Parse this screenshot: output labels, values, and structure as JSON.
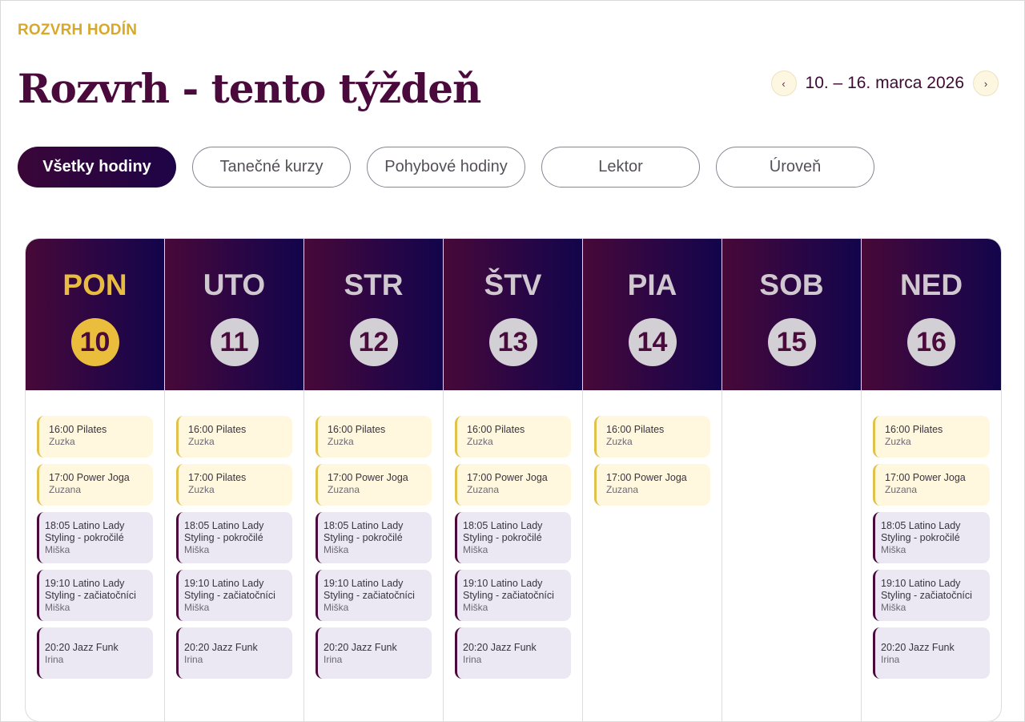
{
  "header": {
    "eyebrow": "ROZVRH HODÍN",
    "title": "Rozvrh - tento týždeň",
    "week_range": "10. – 16. marca 2026",
    "prev_icon": "‹",
    "next_icon": "›"
  },
  "filters": [
    {
      "label": "Všetky hodiny",
      "active": true
    },
    {
      "label": "Tanečné kurzy",
      "active": false
    },
    {
      "label": "Pohybové hodiny",
      "active": false
    },
    {
      "label": "Lektor",
      "active": false
    },
    {
      "label": "Úroveň",
      "active": false
    }
  ],
  "colors": {
    "accent_gold": "#e8bd3f",
    "brand_plum": "#4a0a3c",
    "header_gradient_start": "#470938",
    "header_gradient_end": "#12054b",
    "light_event_bg": "#fff8df",
    "dark_event_bg": "#ebe7f3"
  },
  "days": [
    {
      "name": "PON",
      "num": "10",
      "today": true,
      "events": [
        {
          "title": "16:00 Pilates",
          "teacher": "Zuzka",
          "style": "light"
        },
        {
          "title": "17:00 Power Joga",
          "teacher": "Zuzana",
          "style": "light"
        },
        {
          "title": "18:05 Latino Lady Styling - pokročilé",
          "teacher": "Miška",
          "style": "dark"
        },
        {
          "title": "19:10 Latino Lady Styling - začiatočníci",
          "teacher": "Miška",
          "style": "dark"
        },
        {
          "title": "20:20 Jazz Funk",
          "teacher": "Irina",
          "style": "dark"
        }
      ]
    },
    {
      "name": "UTO",
      "num": "11",
      "today": false,
      "events": [
        {
          "title": "16:00 Pilates",
          "teacher": "Zuzka",
          "style": "light"
        },
        {
          "title": "17:00 Pilates",
          "teacher": "Zuzka",
          "style": "light"
        },
        {
          "title": "18:05 Latino Lady Styling - pokročilé",
          "teacher": "Miška",
          "style": "dark"
        },
        {
          "title": "19:10 Latino Lady Styling - začiatočníci",
          "teacher": "Miška",
          "style": "dark"
        },
        {
          "title": "20:20 Jazz Funk",
          "teacher": "Irina",
          "style": "dark"
        }
      ]
    },
    {
      "name": "STR",
      "num": "12",
      "today": false,
      "events": [
        {
          "title": "16:00 Pilates",
          "teacher": "Zuzka",
          "style": "light"
        },
        {
          "title": "17:00 Power Joga",
          "teacher": "Zuzana",
          "style": "light"
        },
        {
          "title": "18:05 Latino Lady Styling - pokročilé",
          "teacher": "Miška",
          "style": "dark"
        },
        {
          "title": "19:10 Latino Lady Styling - začiatočníci",
          "teacher": "Miška",
          "style": "dark"
        },
        {
          "title": "20:20 Jazz Funk",
          "teacher": "Irina",
          "style": "dark"
        }
      ]
    },
    {
      "name": "ŠTV",
      "num": "13",
      "today": false,
      "events": [
        {
          "title": "16:00 Pilates",
          "teacher": "Zuzka",
          "style": "light"
        },
        {
          "title": "17:00 Power Joga",
          "teacher": "Zuzana",
          "style": "light"
        },
        {
          "title": "18:05 Latino Lady Styling - pokročilé",
          "teacher": "Miška",
          "style": "dark"
        },
        {
          "title": "19:10 Latino Lady Styling - začiatočníci",
          "teacher": "Miška",
          "style": "dark"
        },
        {
          "title": "20:20 Jazz Funk",
          "teacher": "Irina",
          "style": "dark"
        }
      ]
    },
    {
      "name": "PIA",
      "num": "14",
      "today": false,
      "events": [
        {
          "title": "16:00 Pilates",
          "teacher": "Zuzka",
          "style": "light"
        },
        {
          "title": "17:00 Power Joga",
          "teacher": "Zuzana",
          "style": "light"
        }
      ]
    },
    {
      "name": "SOB",
      "num": "15",
      "today": false,
      "events": []
    },
    {
      "name": "NED",
      "num": "16",
      "today": false,
      "events": [
        {
          "title": "16:00 Pilates",
          "teacher": "Zuzka",
          "style": "light"
        },
        {
          "title": "17:00 Power Joga",
          "teacher": "Zuzana",
          "style": "light"
        },
        {
          "title": "18:05 Latino Lady Styling - pokročilé",
          "teacher": "Miška",
          "style": "dark"
        },
        {
          "title": "19:10 Latino Lady Styling - začiatočníci",
          "teacher": "Miška",
          "style": "dark"
        },
        {
          "title": "20:20 Jazz Funk",
          "teacher": "Irina",
          "style": "dark"
        }
      ]
    }
  ]
}
